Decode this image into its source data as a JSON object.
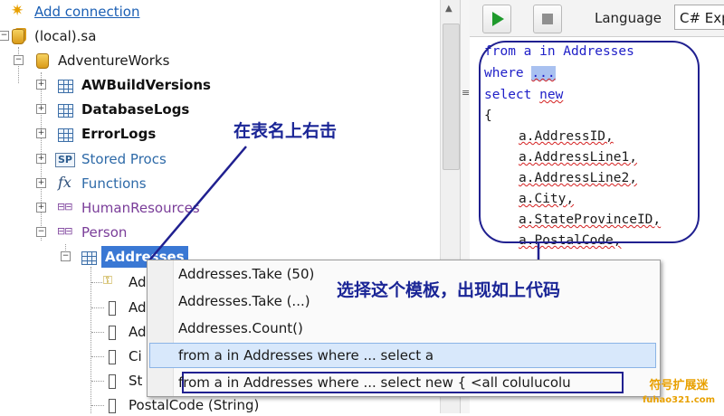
{
  "tree": {
    "add_connection": "Add connection",
    "server": "(local).sa",
    "database": "AdventureWorks",
    "tables": [
      "AWBuildVersions",
      "DatabaseLogs",
      "ErrorLogs"
    ],
    "stored_procs": "Stored Procs",
    "functions": "Functions",
    "schema_hr": "HumanResources",
    "schema_person": "Person",
    "selected_table": "Addresses",
    "columns": [
      "Ad",
      "Ad",
      "Ad",
      "Ci",
      "St"
    ],
    "column_full": "PostalCode (String)",
    "sp_icon_text": "SP",
    "fx_icon_text": "fx"
  },
  "toolbar": {
    "language_label": "Language",
    "language_value": "C# Exp"
  },
  "code": {
    "l1": "from a in Addresses",
    "l2_kw": "where",
    "l2_sel": "...",
    "l3_kw": "select",
    "l3_new": "new",
    "l4": "{",
    "fields": [
      "a.AddressID,",
      "a.AddressLine1,",
      "a.AddressLine2,",
      "a.City,",
      "a.StateProvinceID,",
      "a.PostalCode,"
    ]
  },
  "context_menu": {
    "items": [
      "Addresses.Take (50)",
      "Addresses.Take (...)",
      "Addresses.Count()",
      "from a in Addresses where ...  select a",
      "from a in Addresses where ...  select new { <all colulucolu"
    ]
  },
  "annotations": {
    "right_click": "在表名上右击",
    "choose_template": "选择这个模板，出现如上代码"
  },
  "watermark": {
    "line1": "符号扩展迷",
    "line2": "fuhao321.com"
  },
  "colors": {
    "annotation_ink": "#1a2596",
    "selection": "#3a78d4",
    "keyword": "#2020c8",
    "watermark": "#e8a000"
  }
}
